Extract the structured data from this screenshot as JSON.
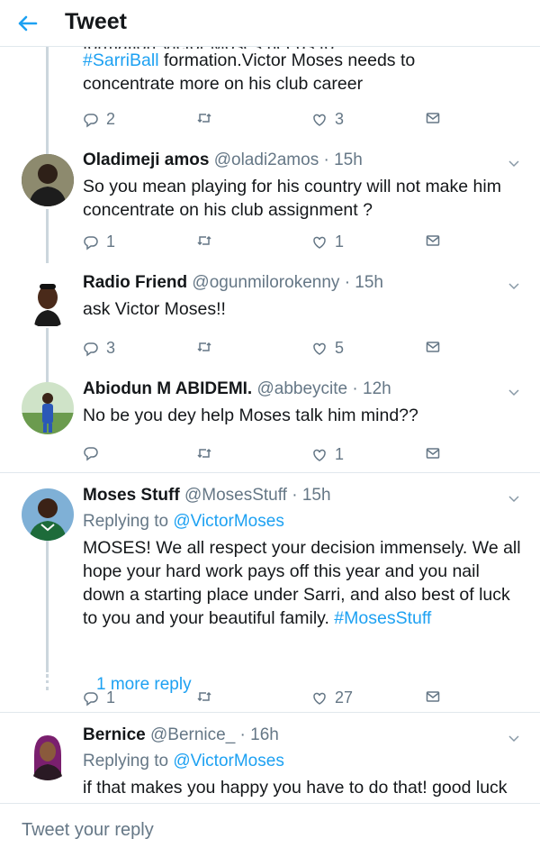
{
  "header": {
    "title": "Tweet"
  },
  "top_tweet": {
    "lines": [
      {
        "hashtag": "#SarriBall",
        "rest": " formation.Victor Moses needs to"
      },
      {
        "plain": "concentrate more on his club career"
      }
    ],
    "replies": "2",
    "likes": "3"
  },
  "tweets": [
    {
      "name": "Oladimeji amos",
      "handle": "@oladi2amos",
      "time": "· 15h",
      "text": "So you mean playing for his country will not make him concentrate on his club assignment ?",
      "replies": "1",
      "likes": "1"
    },
    {
      "name": "Radio Friend",
      "handle": "@ogunmilorokenny",
      "time": "· 15h",
      "text": "ask Victor Moses!!",
      "replies": "3",
      "likes": "5"
    },
    {
      "name": "Abiodun M ABIDEMI.",
      "handle": "@abbeycite",
      "time": "· 12h",
      "text": "No be you dey help Moses talk him mind??",
      "replies": "",
      "likes": "1"
    },
    {
      "name": "Moses Stuff",
      "handle": "@MosesStuff",
      "time": "· 15h",
      "replying_prefix": "Replying to ",
      "replying_to": "@VictorMoses",
      "text": "MOSES! We all respect your decision immensely. We all hope your hard work pays off this year and you nail down a starting place under Sarri, and also best of luck to you and your beautiful family. ",
      "hashtag": "#MosesStuff",
      "replies": "1",
      "likes": "27",
      "more_replies": "1 more reply"
    },
    {
      "name": "Bernice",
      "handle": "@Bernice_",
      "time": "· 16h",
      "replying_prefix": "Replying to ",
      "replying_to": "@VictorMoses",
      "text": "if that makes you happy you have to do that! good luck"
    }
  ],
  "reply_bar": {
    "placeholder": "Tweet your reply"
  },
  "icons": {
    "back": "back-arrow-icon",
    "reply": "reply-icon",
    "retweet": "retweet-icon",
    "like": "like-icon",
    "dm": "message-icon",
    "more": "chevron-down-icon"
  },
  "colors": {
    "accent": "#1da1f2",
    "muted": "#657786",
    "text": "#14171a",
    "line": "#ccd6dd"
  }
}
